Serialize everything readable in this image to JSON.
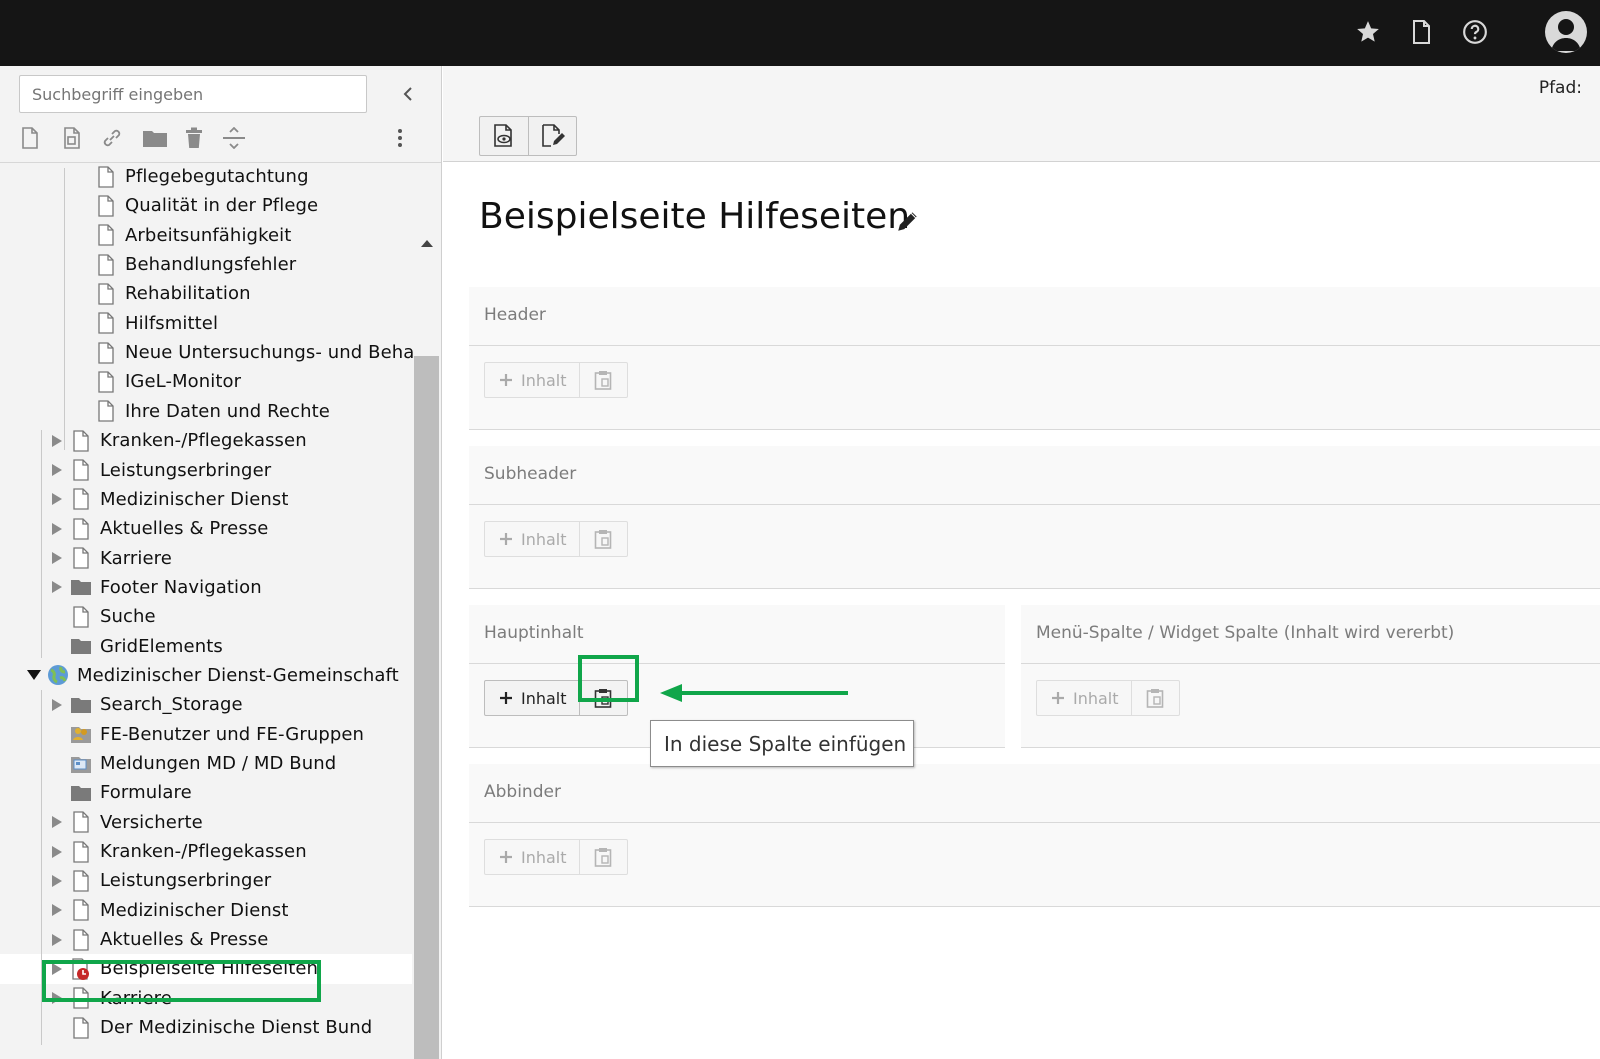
{
  "topbar": {
    "icons": [
      "star-icon",
      "document-icon",
      "help-icon",
      "user-avatar-icon"
    ]
  },
  "tree": {
    "search_placeholder": "Suchbegriff eingeben",
    "toolbar_icons": [
      "new-page-icon",
      "new-page-from-template-icon",
      "link-icon",
      "folder-icon",
      "trash-icon",
      "separator-icon",
      "more-icon"
    ],
    "nodes": [
      {
        "label": "Pflegebegutachtung",
        "icon": "page-icon"
      },
      {
        "label": "Qualität in der Pflege",
        "icon": "page-icon"
      },
      {
        "label": "Arbeitsunfähigkeit",
        "icon": "page-icon"
      },
      {
        "label": "Behandlungsfehler",
        "icon": "page-icon"
      },
      {
        "label": "Rehabilitation",
        "icon": "page-icon"
      },
      {
        "label": "Hilfsmittel",
        "icon": "page-icon"
      },
      {
        "label": "Neue Untersuchungs- und Beha",
        "icon": "page-icon"
      },
      {
        "label": "IGeL-Monitor",
        "icon": "page-icon"
      },
      {
        "label": "Ihre Daten und Rechte",
        "icon": "page-icon"
      },
      {
        "label": "Kranken-/Pflegekassen",
        "icon": "page-icon"
      },
      {
        "label": "Leistungserbringer",
        "icon": "page-icon"
      },
      {
        "label": "Medizinischer Dienst",
        "icon": "page-icon"
      },
      {
        "label": "Aktuelles & Presse",
        "icon": "page-icon"
      },
      {
        "label": "Karriere",
        "icon": "page-icon"
      },
      {
        "label": "Footer Navigation",
        "icon": "folder-icon"
      },
      {
        "label": "Suche",
        "icon": "page-icon"
      },
      {
        "label": "GridElements",
        "icon": "folder-icon"
      },
      {
        "label": "Medizinischer Dienst-Gemeinschaft",
        "icon": "globe-icon"
      },
      {
        "label": "Search_Storage",
        "icon": "folder-icon"
      },
      {
        "label": "FE-Benutzer und FE-Gruppen",
        "icon": "users-folder-icon"
      },
      {
        "label": "Meldungen MD / MD Bund",
        "icon": "news-folder-icon"
      },
      {
        "label": "Formulare",
        "icon": "folder-icon"
      },
      {
        "label": "Versicherte",
        "icon": "page-icon"
      },
      {
        "label": "Kranken-/Pflegekassen",
        "icon": "page-icon"
      },
      {
        "label": "Leistungserbringer",
        "icon": "page-icon"
      },
      {
        "label": "Medizinischer Dienst",
        "icon": "page-icon"
      },
      {
        "label": "Aktuelles & Presse",
        "icon": "page-icon"
      },
      {
        "label": "Beispielseite Hilfeseiten",
        "icon": "page-hidden-icon"
      },
      {
        "label": "Karriere",
        "icon": "page-icon"
      },
      {
        "label": "Der Medizinische Dienst Bund",
        "icon": "page-icon"
      }
    ]
  },
  "main": {
    "path_label": "Pfad:",
    "toolbar_icons": [
      "view-page-icon",
      "edit-page-properties-icon"
    ],
    "page_title": "Beispielseite Hilfeseiten",
    "add_content_label": "Inhalt",
    "columns": {
      "header": "Header",
      "subheader": "Subheader",
      "hauptinhalt": "Hauptinhalt",
      "menu_spalte": "Menü-Spalte / Widget Spalte (Inhalt wird vererbt)",
      "abbinder": "Abbinder"
    },
    "tooltip": "In diese Spalte einfügen",
    "highlight_color": "#10a64a"
  }
}
